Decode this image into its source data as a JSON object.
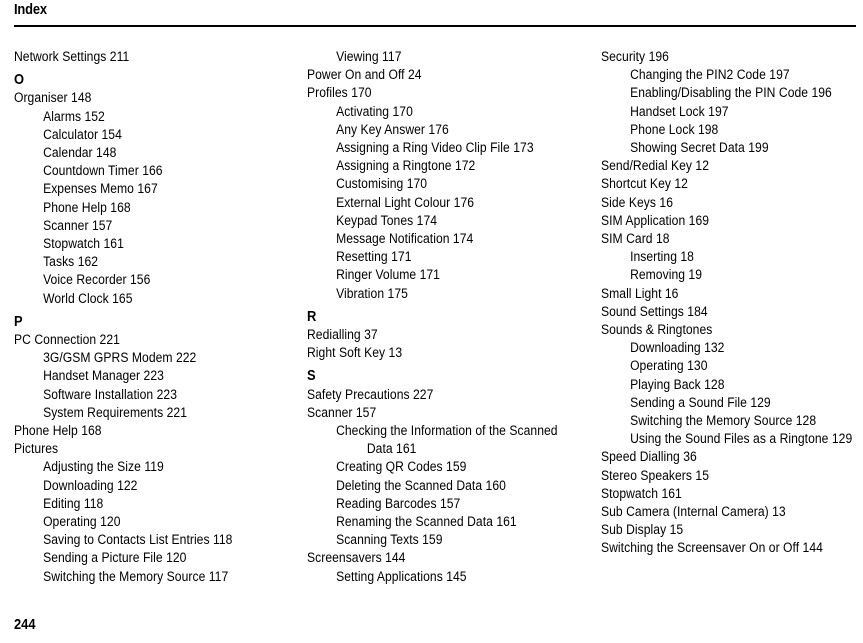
{
  "header": {
    "title": "Index"
  },
  "footer": {
    "page_number": "244"
  },
  "columns": [
    {
      "id": "column-1",
      "blocks": [
        {
          "type": "entry",
          "text": "Network Settings 211"
        },
        {
          "type": "letter",
          "text": "O"
        },
        {
          "type": "entry",
          "text": "Organiser 148"
        },
        {
          "type": "sub",
          "text": "Alarms 152"
        },
        {
          "type": "sub",
          "text": "Calculator 154"
        },
        {
          "type": "sub",
          "text": "Calendar 148"
        },
        {
          "type": "sub",
          "text": "Countdown Timer 166"
        },
        {
          "type": "sub",
          "text": "Expenses Memo 167"
        },
        {
          "type": "sub",
          "text": "Phone Help 168"
        },
        {
          "type": "sub",
          "text": "Scanner 157"
        },
        {
          "type": "sub",
          "text": "Stopwatch 161"
        },
        {
          "type": "sub",
          "text": "Tasks 162"
        },
        {
          "type": "sub",
          "text": "Voice Recorder 156"
        },
        {
          "type": "sub",
          "text": "World Clock 165"
        },
        {
          "type": "letter",
          "text": "P"
        },
        {
          "type": "entry",
          "text": "PC Connection 221"
        },
        {
          "type": "sub",
          "text": "3G/GSM GPRS Modem 222"
        },
        {
          "type": "sub",
          "text": "Handset Manager 223"
        },
        {
          "type": "sub",
          "text": "Software Installation 223"
        },
        {
          "type": "sub",
          "text": "System Requirements 221"
        },
        {
          "type": "entry",
          "text": "Phone Help 168"
        },
        {
          "type": "entry",
          "text": "Pictures"
        },
        {
          "type": "sub",
          "text": "Adjusting the Size 119"
        },
        {
          "type": "sub",
          "text": "Downloading 122"
        },
        {
          "type": "sub",
          "text": "Editing 118"
        },
        {
          "type": "sub",
          "text": "Operating 120"
        },
        {
          "type": "sub",
          "text": "Saving to Contacts List Entries 118"
        },
        {
          "type": "sub",
          "text": "Sending a Picture File 120"
        },
        {
          "type": "sub",
          "text": "Switching the Memory Source 117"
        }
      ]
    },
    {
      "id": "column-2",
      "blocks": [
        {
          "type": "sub",
          "text": "Viewing 117"
        },
        {
          "type": "entry",
          "text": "Power On and Off 24"
        },
        {
          "type": "entry",
          "text": "Profiles 170"
        },
        {
          "type": "sub",
          "text": "Activating 170"
        },
        {
          "type": "sub",
          "text": "Any Key Answer 176"
        },
        {
          "type": "sub",
          "text": "Assigning a Ring Video Clip File 173"
        },
        {
          "type": "sub",
          "text": "Assigning a Ringtone 172"
        },
        {
          "type": "sub",
          "text": "Customising 170"
        },
        {
          "type": "sub",
          "text": "External Light Colour 176"
        },
        {
          "type": "sub",
          "text": "Keypad Tones 174"
        },
        {
          "type": "sub",
          "text": "Message Notification 174"
        },
        {
          "type": "sub",
          "text": "Resetting 171"
        },
        {
          "type": "sub",
          "text": "Ringer Volume 171"
        },
        {
          "type": "sub",
          "text": "Vibration 175"
        },
        {
          "type": "letter",
          "text": "R"
        },
        {
          "type": "entry",
          "text": "Redialling 37"
        },
        {
          "type": "entry",
          "text": "Right Soft Key 13"
        },
        {
          "type": "letter",
          "text": "S"
        },
        {
          "type": "entry",
          "text": "Safety Precautions 227"
        },
        {
          "type": "entry",
          "text": "Scanner 157"
        },
        {
          "type": "wrap",
          "text": "Checking the Information of the Scanned",
          "continuation": "Data 161"
        },
        {
          "type": "sub",
          "text": "Creating QR Codes 159"
        },
        {
          "type": "sub",
          "text": "Deleting the Scanned Data 160"
        },
        {
          "type": "sub",
          "text": "Reading Barcodes 157"
        },
        {
          "type": "sub",
          "text": "Renaming the Scanned Data 161"
        },
        {
          "type": "sub",
          "text": "Scanning Texts 159"
        },
        {
          "type": "entry",
          "text": "Screensavers 144"
        },
        {
          "type": "sub",
          "text": "Setting Applications 145"
        }
      ]
    },
    {
      "id": "column-3",
      "blocks": [
        {
          "type": "entry",
          "text": "Security 196"
        },
        {
          "type": "sub",
          "text": "Changing the PIN2 Code 197"
        },
        {
          "type": "sub",
          "text": "Enabling/Disabling the PIN Code 196"
        },
        {
          "type": "sub",
          "text": "Handset Lock 197"
        },
        {
          "type": "sub",
          "text": "Phone Lock 198"
        },
        {
          "type": "sub",
          "text": "Showing Secret Data 199"
        },
        {
          "type": "entry",
          "text": "Send/Redial Key 12"
        },
        {
          "type": "entry",
          "text": "Shortcut Key 12"
        },
        {
          "type": "entry",
          "text": "Side Keys 16"
        },
        {
          "type": "entry",
          "text": "SIM Application 169"
        },
        {
          "type": "entry",
          "text": "SIM Card 18"
        },
        {
          "type": "sub",
          "text": "Inserting 18"
        },
        {
          "type": "sub",
          "text": "Removing 19"
        },
        {
          "type": "entry",
          "text": "Small Light 16"
        },
        {
          "type": "entry",
          "text": "Sound Settings 184"
        },
        {
          "type": "entry",
          "text": "Sounds & Ringtones"
        },
        {
          "type": "sub",
          "text": "Downloading 132"
        },
        {
          "type": "sub",
          "text": "Operating 130"
        },
        {
          "type": "sub",
          "text": "Playing Back 128"
        },
        {
          "type": "sub",
          "text": "Sending a Sound File 129"
        },
        {
          "type": "sub",
          "text": "Switching the Memory Source 128"
        },
        {
          "type": "sub",
          "text": "Using the Sound Files as a Ringtone 129"
        },
        {
          "type": "entry",
          "text": "Speed Dialling 36"
        },
        {
          "type": "entry",
          "text": "Stereo Speakers 15"
        },
        {
          "type": "entry",
          "text": "Stopwatch 161"
        },
        {
          "type": "entry",
          "text": "Sub Camera (Internal Camera) 13"
        },
        {
          "type": "entry",
          "text": "Sub Display 15"
        },
        {
          "type": "entry",
          "text": "Switching the Screensaver On or Off 144"
        }
      ]
    }
  ]
}
